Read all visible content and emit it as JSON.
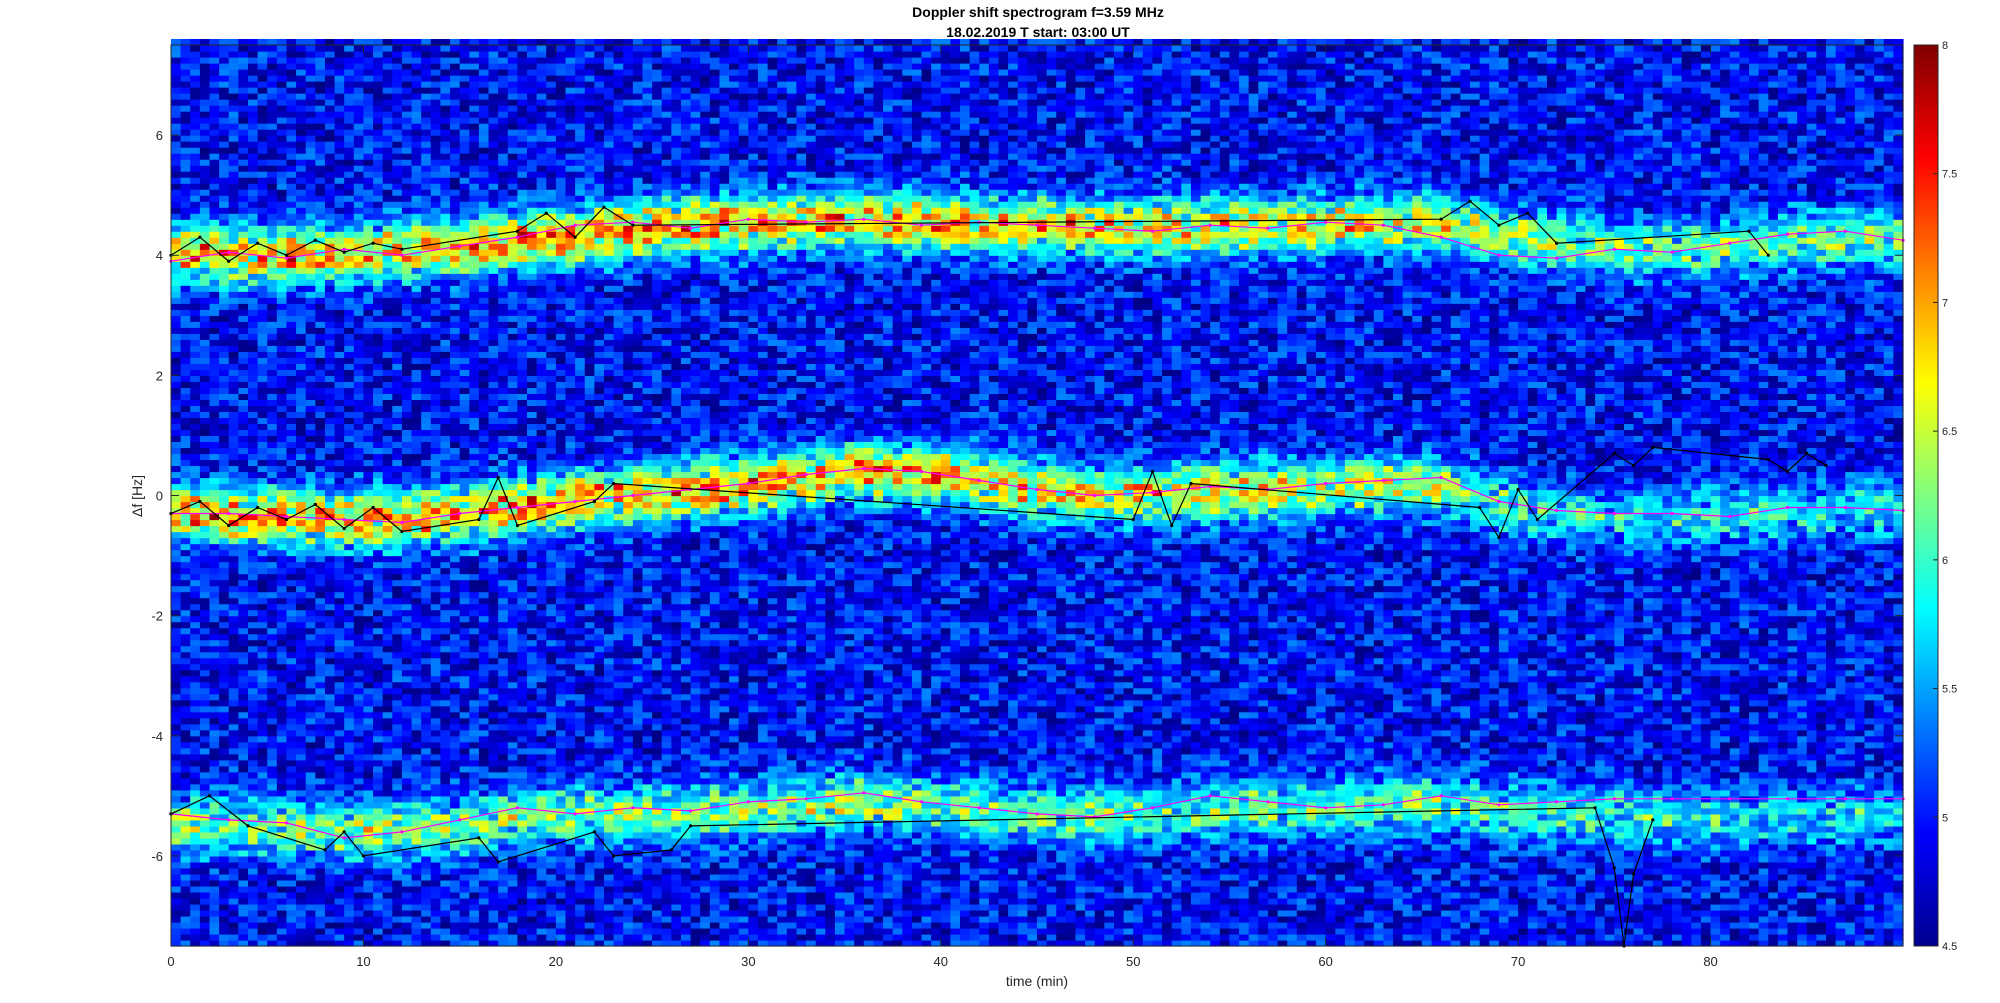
{
  "chart_data": {
    "type": "heatmap",
    "title": "Doppler shift spectrogram f=3.59 MHz",
    "subtitle": "18.02.2019    T start: 03:00 UT",
    "xlabel": "time (min)",
    "ylabel": "Δf [Hz]",
    "xlim": [
      0,
      90
    ],
    "ylim": [
      -7.5,
      7.5
    ],
    "xticks": [
      0,
      10,
      20,
      30,
      40,
      50,
      60,
      70,
      80
    ],
    "yticks": [
      -6,
      -4,
      -2,
      0,
      2,
      4,
      6
    ],
    "colorbar": {
      "colormap": "jet",
      "clim": [
        4.5,
        8
      ],
      "ticks": [
        4.5,
        5,
        5.5,
        6,
        6.5,
        7,
        7.5,
        8
      ]
    },
    "bands": [
      {
        "name": "",
        "center_time_min": [
          0,
          5,
          10,
          15,
          20,
          25,
          30,
          35,
          40,
          45,
          50,
          55,
          60,
          65,
          70,
          75,
          80,
          85,
          90
        ],
        "center_hz": [
          4.0,
          4.0,
          4.05,
          4.15,
          4.3,
          4.45,
          4.55,
          4.6,
          4.55,
          4.5,
          4.45,
          4.5,
          4.5,
          4.55,
          4.3,
          4.1,
          4.1,
          4.3,
          4.3
        ],
        "intensity": [
          6.6,
          6.6,
          6.5,
          6.6,
          6.7,
          6.7,
          6.6,
          6.5,
          6.5,
          6.5,
          6.4,
          6.4,
          6.3,
          6.2,
          5.9,
          5.8,
          5.7,
          5.8,
          5.8
        ]
      },
      {
        "name": "",
        "center_time_min": [
          0,
          5,
          10,
          15,
          20,
          25,
          30,
          35,
          40,
          45,
          50,
          55,
          60,
          65,
          70,
          75,
          80,
          85,
          90
        ],
        "center_hz": [
          -0.3,
          -0.35,
          -0.4,
          -0.3,
          -0.1,
          0.05,
          0.2,
          0.4,
          0.35,
          0.1,
          0.0,
          0.1,
          0.15,
          0.2,
          -0.2,
          -0.4,
          -0.3,
          -0.25,
          -0.2
        ],
        "intensity": [
          6.6,
          6.6,
          6.6,
          6.6,
          6.6,
          6.6,
          6.6,
          6.6,
          6.5,
          6.4,
          6.3,
          6.3,
          6.2,
          6.0,
          5.6,
          5.4,
          5.4,
          5.4,
          5.4
        ]
      },
      {
        "name": "",
        "center_time_min": [
          0,
          5,
          10,
          15,
          20,
          25,
          30,
          35,
          40,
          45,
          50,
          55,
          60,
          65,
          70,
          75,
          80,
          85,
          90
        ],
        "center_hz": [
          -5.5,
          -5.5,
          -5.6,
          -5.5,
          -5.3,
          -5.3,
          -5.25,
          -5.1,
          -5.15,
          -5.3,
          -5.35,
          -5.2,
          -5.2,
          -5.1,
          -5.25,
          -5.3,
          -5.4,
          -5.35,
          -5.3
        ],
        "intensity": [
          5.9,
          5.9,
          5.9,
          5.9,
          5.8,
          5.8,
          5.9,
          5.9,
          5.8,
          5.8,
          5.7,
          5.7,
          5.7,
          5.8,
          5.6,
          5.5,
          5.4,
          5.3,
          5.3
        ]
      }
    ],
    "tracks": [
      {
        "name": "",
        "color": "#ff00ff",
        "time_min": [
          0,
          3,
          6,
          9,
          12,
          15,
          18,
          21,
          24,
          27,
          30,
          33,
          36,
          39,
          42,
          45,
          48,
          51,
          54,
          57,
          60,
          63,
          66,
          69,
          72,
          75,
          78,
          81,
          84,
          87,
          90
        ],
        "hz": [
          3.9,
          4.05,
          3.95,
          4.1,
          4.0,
          4.15,
          4.3,
          4.5,
          4.55,
          4.45,
          4.6,
          4.55,
          4.6,
          4.5,
          4.55,
          4.5,
          4.45,
          4.4,
          4.5,
          4.45,
          4.55,
          4.5,
          4.3,
          4.0,
          3.95,
          4.1,
          4.05,
          4.2,
          4.35,
          4.4,
          4.25
        ]
      },
      {
        "name": "",
        "color": "#000000",
        "time_min": [
          0,
          1.5,
          3,
          4.5,
          6,
          7.5,
          9,
          10.5,
          12,
          18,
          19.5,
          21,
          22.5,
          24,
          66,
          67.5,
          69,
          70.5,
          72,
          82,
          83
        ],
        "hz": [
          4.0,
          4.3,
          3.9,
          4.2,
          4.0,
          4.25,
          4.05,
          4.2,
          4.1,
          4.4,
          4.7,
          4.3,
          4.8,
          4.5,
          4.6,
          4.9,
          4.5,
          4.7,
          4.2,
          4.4,
          4.0
        ]
      },
      {
        "name": "",
        "color": "#ff00ff",
        "time_min": [
          0,
          3,
          6,
          9,
          12,
          15,
          18,
          21,
          24,
          27,
          30,
          33,
          36,
          39,
          42,
          45,
          48,
          51,
          54,
          57,
          60,
          63,
          66,
          69,
          72,
          75,
          78,
          81,
          84,
          87,
          90
        ],
        "hz": [
          -0.3,
          -0.3,
          -0.35,
          -0.4,
          -0.45,
          -0.3,
          -0.2,
          -0.1,
          0.0,
          0.1,
          0.2,
          0.35,
          0.45,
          0.4,
          0.25,
          0.1,
          0.0,
          0.05,
          0.15,
          0.1,
          0.2,
          0.25,
          0.3,
          -0.1,
          -0.25,
          -0.3,
          -0.3,
          -0.35,
          -0.2,
          -0.2,
          -0.25
        ]
      },
      {
        "name": "",
        "color": "#000000",
        "time_min": [
          0,
          1.5,
          3,
          4.5,
          6,
          7.5,
          9,
          10.5,
          12,
          16,
          17,
          18,
          22,
          23,
          50,
          51,
          52,
          53,
          68,
          69,
          70,
          71,
          75,
          76,
          77,
          83,
          84,
          85,
          86
        ],
        "hz": [
          -0.3,
          -0.1,
          -0.5,
          -0.2,
          -0.4,
          -0.15,
          -0.55,
          -0.2,
          -0.6,
          -0.4,
          0.3,
          -0.5,
          -0.1,
          0.2,
          -0.4,
          0.4,
          -0.5,
          0.2,
          -0.2,
          -0.7,
          0.1,
          -0.4,
          0.7,
          0.5,
          0.8,
          0.6,
          0.4,
          0.7,
          0.5
        ]
      },
      {
        "name": "",
        "color": "#ff00ff",
        "time_min": [
          0,
          3,
          6,
          9,
          12,
          15,
          18,
          21,
          24,
          27,
          30,
          33,
          36,
          39,
          42,
          45,
          48,
          51,
          54,
          57,
          60,
          63,
          66,
          69,
          72,
          75,
          78,
          81,
          84,
          87,
          90
        ],
        "hz": [
          -5.3,
          -5.4,
          -5.45,
          -5.7,
          -5.6,
          -5.4,
          -5.2,
          -5.3,
          -5.2,
          -5.25,
          -5.1,
          -5.05,
          -4.95,
          -5.1,
          -5.2,
          -5.3,
          -5.35,
          -5.2,
          -5.0,
          -5.1,
          -5.2,
          -5.15,
          -5.0,
          -5.15,
          -5.1,
          -5.05,
          -5.05,
          -5.05,
          -5.05,
          -5.05,
          -5.05
        ]
      },
      {
        "name": "",
        "color": "#000000",
        "time_min": [
          0,
          2,
          4,
          8,
          9,
          10,
          16,
          17,
          22,
          23,
          26,
          27,
          74,
          75,
          75.5,
          76,
          77
        ],
        "hz": [
          -5.3,
          -5.0,
          -5.5,
          -5.9,
          -5.6,
          -6.0,
          -5.7,
          -6.1,
          -5.6,
          -6.0,
          -5.9,
          -5.5,
          -5.2,
          -6.2,
          -7.5,
          -6.3,
          -5.4
        ]
      }
    ]
  }
}
